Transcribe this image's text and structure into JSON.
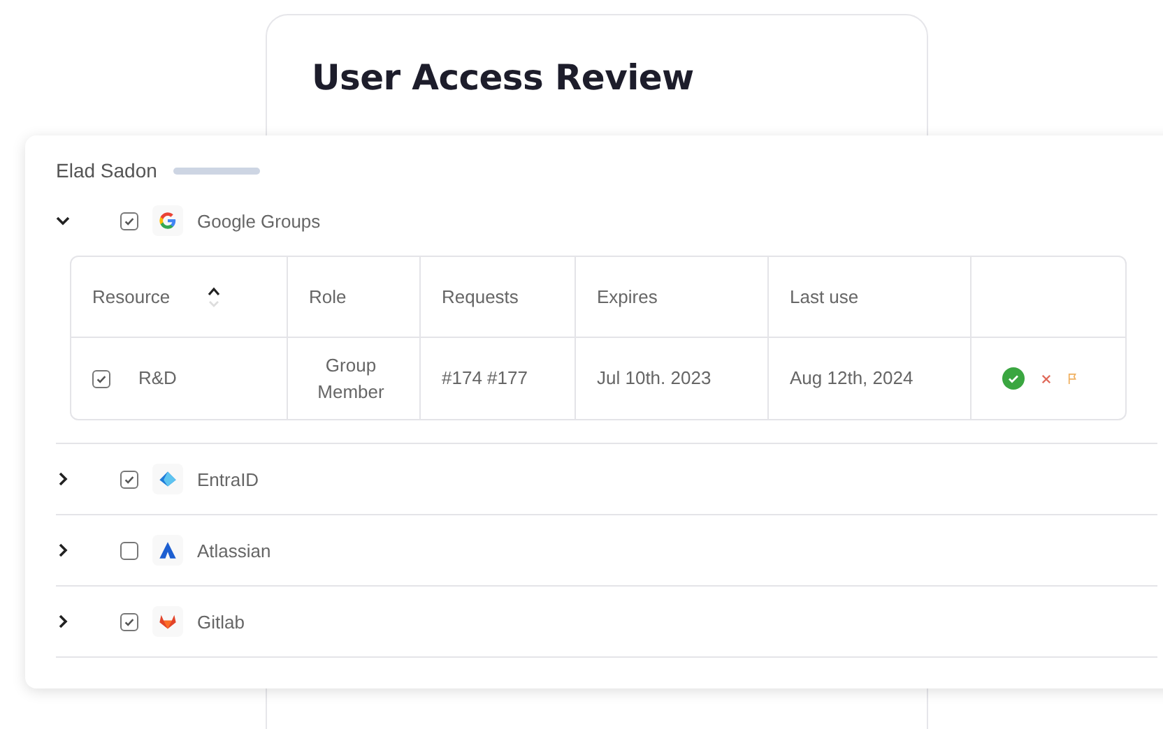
{
  "back_card": {
    "title": "User Access Review"
  },
  "user": {
    "name": "Elad Sadon"
  },
  "apps": [
    {
      "name": "Google Groups",
      "kind": "google",
      "expanded": true,
      "checked": true,
      "table": {
        "columns": [
          {
            "label": "Resource",
            "sortable": true
          },
          {
            "label": "Role",
            "sortable": false
          },
          {
            "label": "Requests",
            "sortable": false
          },
          {
            "label": "Expires",
            "sortable": false
          },
          {
            "label": "Last use",
            "sortable": false
          }
        ],
        "rows": [
          {
            "checked": true,
            "resource": "R&D",
            "role": "Group Member",
            "requests": "#174 #177",
            "expires": "Jul 10th. 2023",
            "last_use": "Aug 12th, 2024",
            "approved": true
          }
        ]
      }
    },
    {
      "name": "EntraID",
      "kind": "entra",
      "expanded": false,
      "checked": true
    },
    {
      "name": "Atlassian",
      "kind": "atlassian",
      "expanded": false,
      "checked": false
    },
    {
      "name": "Gitlab",
      "kind": "gitlab",
      "expanded": false,
      "checked": true
    }
  ]
}
